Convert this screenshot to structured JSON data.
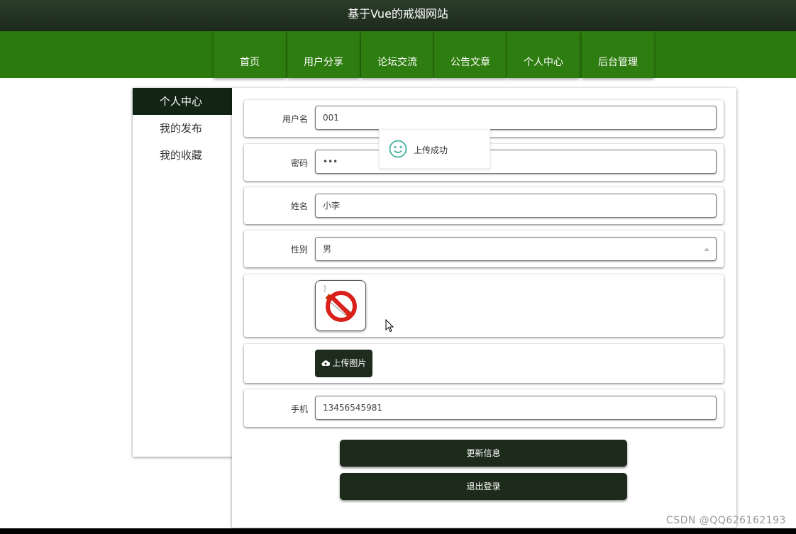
{
  "header": {
    "title": "基于Vue的戒烟网站"
  },
  "nav": {
    "items": [
      {
        "label": "首页"
      },
      {
        "label": "用户分享"
      },
      {
        "label": "论坛交流"
      },
      {
        "label": "公告文章"
      },
      {
        "label": "个人中心"
      },
      {
        "label": "后台管理"
      }
    ]
  },
  "sidebar": {
    "items": [
      {
        "label": "个人中心",
        "active": true
      },
      {
        "label": "我的发布"
      },
      {
        "label": "我的收藏"
      }
    ]
  },
  "form": {
    "username": {
      "label": "用户名",
      "value": "001"
    },
    "password": {
      "label": "密码",
      "value": "•••"
    },
    "name": {
      "label": "姓名",
      "value": "小李"
    },
    "gender": {
      "label": "性别",
      "value": "男"
    },
    "avatar": {
      "icon": "no-smoking-icon"
    },
    "upload": {
      "label": "上传图片",
      "icon": "cloud-upload-icon"
    },
    "phone": {
      "label": "手机",
      "value": "13456545981"
    }
  },
  "actions": {
    "update_label": "更新信息",
    "logout_label": "退出登录"
  },
  "toast": {
    "message": "上传成功",
    "icon": "smiley-icon"
  },
  "watermark": {
    "text": "CSDN @QQ626162193"
  },
  "colors": {
    "header": "#1c2a1b",
    "nav": "#2b7a0e",
    "button": "#1d2b1b",
    "toast_icon": "#40b0a0"
  }
}
